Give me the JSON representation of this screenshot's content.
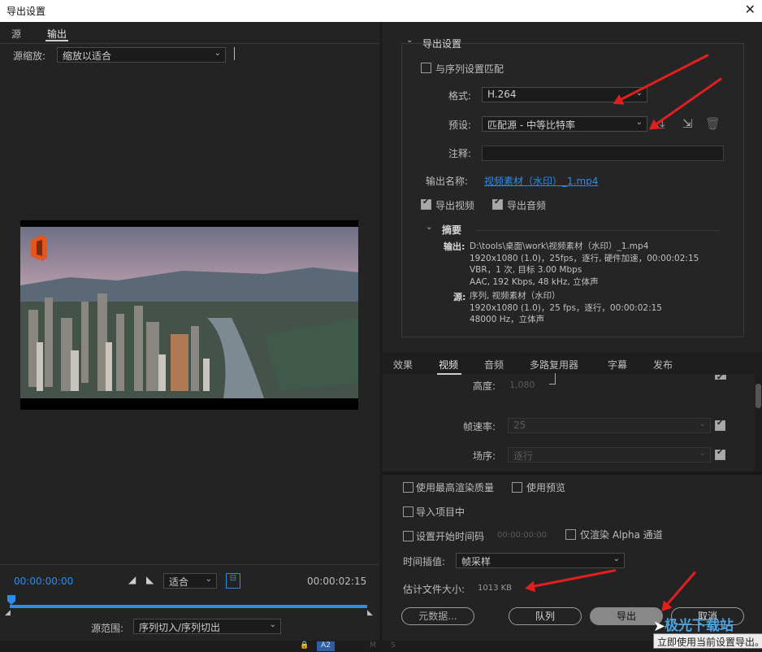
{
  "window": {
    "title": "导出设置",
    "close": "✕"
  },
  "left": {
    "tabs": [
      "源",
      "输出"
    ],
    "zoom_label": "源缩放:",
    "zoom_value": "缩放以适合",
    "timecode_start": "00:00:00:00",
    "timecode_end": "00:00:02:15",
    "fit_value": "适合",
    "range_label": "源范围:",
    "range_value": "序列切入/序列切出"
  },
  "export": {
    "section_title": "导出设置",
    "match_sequence": "与序列设置匹配",
    "format_label": "格式:",
    "format_value": "H.264",
    "preset_label": "预设:",
    "preset_value": "匹配源 - 中等比特率",
    "comment_label": "注释:",
    "output_name_label": "输出名称:",
    "output_name_value": "视频素材（水印）_1.mp4",
    "export_video": "导出视频",
    "export_audio": "导出音频",
    "summary_title": "摘要",
    "summary_output_label": "输出:",
    "summary_output_lines": [
      "D:\\tools\\桌面\\work\\视频素材（水印）_1.mp4",
      "1920x1080 (1.0)，25fps，逐行, 硬件加速，00:00:02:15",
      "VBR，1 次, 目标 3.00 Mbps",
      "AAC, 192 Kbps, 48  kHz, 立体声"
    ],
    "summary_source_label": "源:",
    "summary_source_lines": [
      "序列, 视频素材（水印）",
      "1920x1080 (1.0)，25 fps，逐行，00:00:02:15",
      "48000 Hz，立体声"
    ]
  },
  "tabs": [
    "效果",
    "视频",
    "音频",
    "多路复用器",
    "字幕",
    "发布"
  ],
  "video": {
    "height_label": "高度:",
    "height_value": "1,080",
    "fps_label": "帧速率:",
    "fps_value": "25",
    "field_label": "场序:",
    "field_value": "逐行"
  },
  "bottom": {
    "max_quality": "使用最高渲染质量",
    "use_preview": "使用预览",
    "import_project": "导入项目中",
    "set_start_tc": "设置开始时间码",
    "start_tc_value": "00:00:00:00",
    "alpha_only": "仅渲染 Alpha 通道",
    "interp_label": "时间插值:",
    "interp_value": "帧采样",
    "filesize": "估计文件大小:",
    "filesize_value": "1013 KB",
    "metadata_btn": "元数据...",
    "queue_btn": "队列",
    "export_btn": "导出",
    "cancel_btn": "取消",
    "tooltip": "立即使用当前设置导出。",
    "watermark": "极光下载站"
  },
  "strip": {
    "track": "A2",
    "m": "M",
    "s": "S"
  }
}
